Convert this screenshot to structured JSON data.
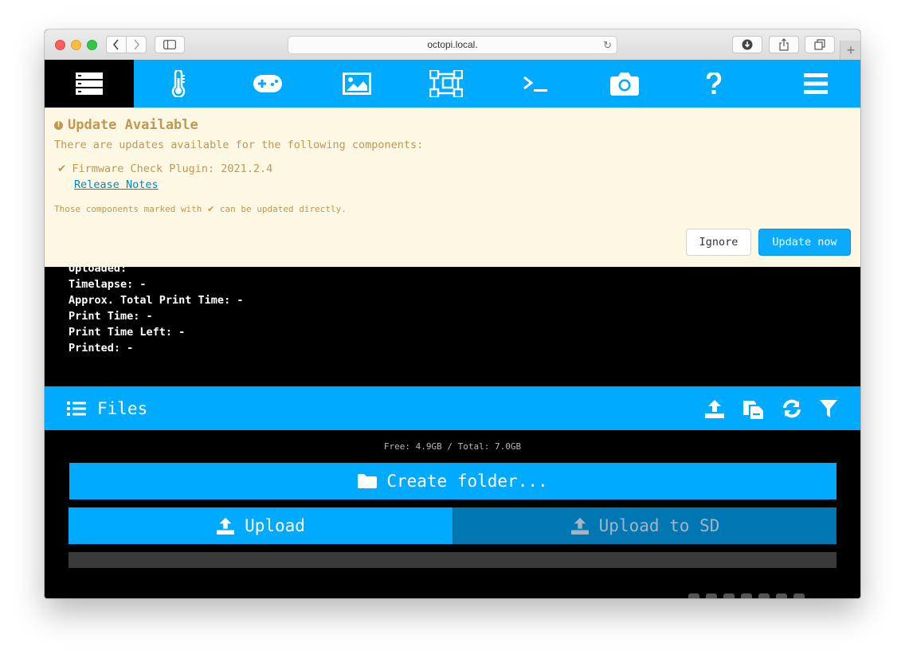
{
  "browser": {
    "url": "octopi.local.",
    "new_tab_symbol": "+"
  },
  "nav": {
    "items": [
      {
        "name": "state",
        "icon": "server-icon",
        "active": true
      },
      {
        "name": "temperature",
        "icon": "thermometer-icon"
      },
      {
        "name": "control",
        "icon": "gamepad-icon"
      },
      {
        "name": "gcode-viewer",
        "icon": "image-icon"
      },
      {
        "name": "print-view",
        "icon": "vector-square-icon"
      },
      {
        "name": "terminal",
        "icon": "terminal-icon"
      },
      {
        "name": "timelapse",
        "icon": "camera-icon"
      },
      {
        "name": "help",
        "icon": "question-icon"
      },
      {
        "name": "menu",
        "icon": "hamburger-menu-icon"
      }
    ]
  },
  "update": {
    "title": "Update Available",
    "description": "There are updates available for the following components:",
    "component": "Firmware Check Plugin: 2021.2.4",
    "release_notes": "Release Notes",
    "note_before": "Those components marked with",
    "note_after": "can be updated directly.",
    "ignore_label": "Ignore",
    "update_label": "Update now",
    "colors": {
      "background": "#fcf8e3",
      "text": "#c09853"
    }
  },
  "state": {
    "lines": [
      "Uploaded:",
      "Timelapse: -",
      "Approx. Total Print Time: -",
      "Print Time: -",
      "Print Time Left: -",
      "Printed: -"
    ]
  },
  "files": {
    "title": "Files",
    "free_space": "Free: 4.9GB / Total: 7.0GB",
    "create_folder": "Create folder...",
    "upload": "Upload",
    "upload_sd": "Upload to SD",
    "header_icons": [
      "upload-icon",
      "sd-card-icon",
      "refresh-icon",
      "filter-icon"
    ]
  },
  "colors": {
    "accent": "#00aaff",
    "dark_accent": "#0077b3",
    "background": "#000000"
  }
}
